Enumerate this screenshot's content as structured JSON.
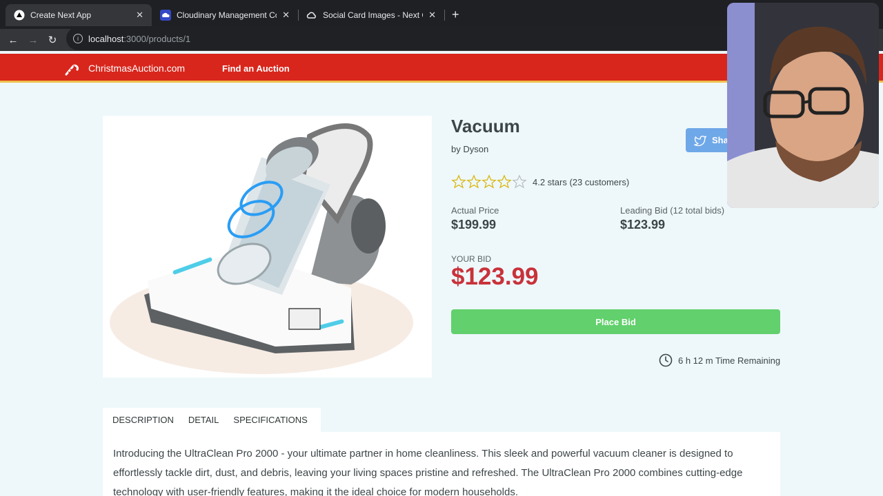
{
  "browser": {
    "tabs": [
      {
        "title": "Create Next App",
        "active": true
      },
      {
        "title": "Cloudinary Management Cons",
        "active": false
      },
      {
        "title": "Social Card Images - Next Clo",
        "active": false
      }
    ],
    "url_host": "localhost",
    "url_path": ":3000/products/1"
  },
  "site": {
    "logo_text": "ChristmasAuction.com",
    "nav_link": "Find an Auction"
  },
  "product": {
    "title": "Vacuum",
    "brand": "by Dyson",
    "share_label": "Sha",
    "rating_value": 4.2,
    "rating_text": "4.2 stars (23 customers)",
    "actual_price_label": "Actual Price",
    "actual_price": "$199.99",
    "leading_bid_label": "Leading Bid (12 total bids)",
    "leading_bid": "$123.99",
    "your_bid_label": "YOUR BID",
    "your_bid": "$123.99",
    "place_bid_label": "Place Bid",
    "time_remaining": "6 h 12 m Time Remaining"
  },
  "tabs": [
    "DESCRIPTION",
    "DETAIL",
    "SPECIFICATIONS"
  ],
  "description": "Introducing the UltraClean Pro 2000 - your ultimate partner in home cleanliness. This sleek and powerful vacuum cleaner is designed to effortlessly tackle dirt, dust, and debris, leaving your living spaces pristine and refreshed. The UltraClean Pro 2000 combines cutting-edge technology with user-friendly features, making it the ideal choice for modern households.",
  "colors": {
    "header_red": "#d8261c",
    "price_red": "#c8323a",
    "bid_green": "#62d06c",
    "share_blue": "#6fa8e8"
  }
}
